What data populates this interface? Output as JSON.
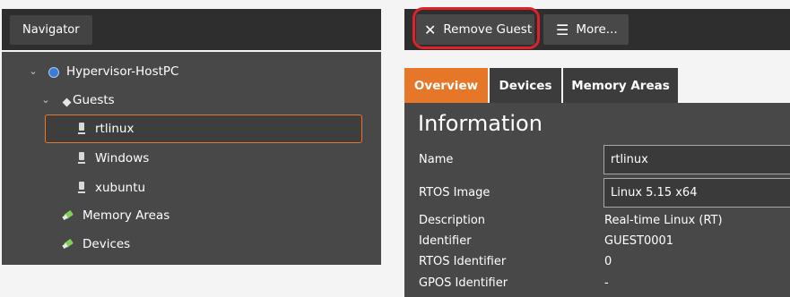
{
  "navigator": {
    "title": "Navigator",
    "tree": {
      "root_label": "Hypervisor-HostPC",
      "guests_label": "Guests",
      "guests": [
        "rtlinux",
        "Windows",
        "xubuntu"
      ],
      "memory_areas_label": "Memory Areas",
      "devices_label": "Devices",
      "selected_guest": "rtlinux"
    }
  },
  "toolbar": {
    "remove_guest_label": "Remove Guest",
    "more_label": "More..."
  },
  "tabs": [
    {
      "label": "Overview",
      "active": true
    },
    {
      "label": "Devices",
      "active": false
    },
    {
      "label": "Memory Areas",
      "active": false
    }
  ],
  "information": {
    "title": "Information",
    "name_label": "Name",
    "name_value": "rtlinux",
    "rtos_image_label": "RTOS Image",
    "rtos_image_value": "Linux 5.15 x64",
    "description_label": "Description",
    "description_value": "Real-time Linux (RT)",
    "identifier_label": "Identifier",
    "identifier_value": "GUEST0001",
    "rtos_identifier_label": "RTOS Identifier",
    "rtos_identifier_value": "0",
    "gpos_identifier_label": "GPOS Identifier",
    "gpos_identifier_value": "-"
  },
  "colors": {
    "accent": "#e77728",
    "highlight_ring": "#e0202a",
    "panel_bg": "#484848",
    "header_bg": "#2e2e2e"
  },
  "icons": {
    "root": "globe-icon",
    "guests": "gear-icon",
    "guest": "guest-icon",
    "memory_areas": "leaf-icon",
    "devices": "leaf-icon",
    "remove": "close-icon",
    "more": "hamburger-icon"
  }
}
